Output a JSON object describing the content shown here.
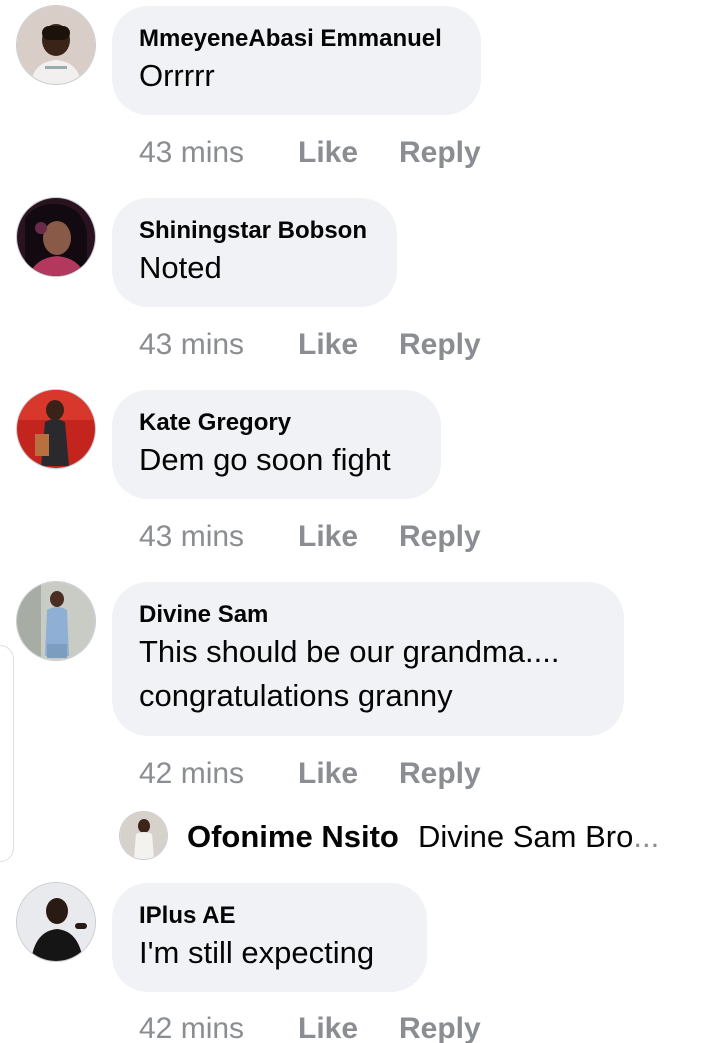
{
  "comments": [
    {
      "author": "MmeyeneAbasi Emmanuel",
      "lines": [
        "Orrrrr"
      ],
      "time": "43 mins",
      "like": "Like",
      "reply": "Reply"
    },
    {
      "author": "Shiningstar Bobson",
      "lines": [
        "Noted"
      ],
      "time": "43 mins",
      "like": "Like",
      "reply": "Reply"
    },
    {
      "author": "Kate Gregory",
      "lines": [
        "Dem go soon fight"
      ],
      "time": "43 mins",
      "like": "Like",
      "reply": "Reply"
    },
    {
      "author": "Divine Sam",
      "lines": [
        "This should be our grandma....",
        "congratulations granny"
      ],
      "time": "42 mins",
      "like": "Like",
      "reply": "Reply"
    },
    {
      "author": "IPlus AE",
      "lines": [
        "I'm still expecting"
      ],
      "time": "42 mins",
      "like": "Like",
      "reply": "Reply"
    }
  ],
  "reply_preview": {
    "author": "Ofonime Nsito",
    "text": "Divine Sam Bro",
    "ellipsis": "..."
  },
  "colors": {
    "bubble": "#f0f2f5",
    "text": "#050505",
    "meta": "#8a8d91"
  }
}
